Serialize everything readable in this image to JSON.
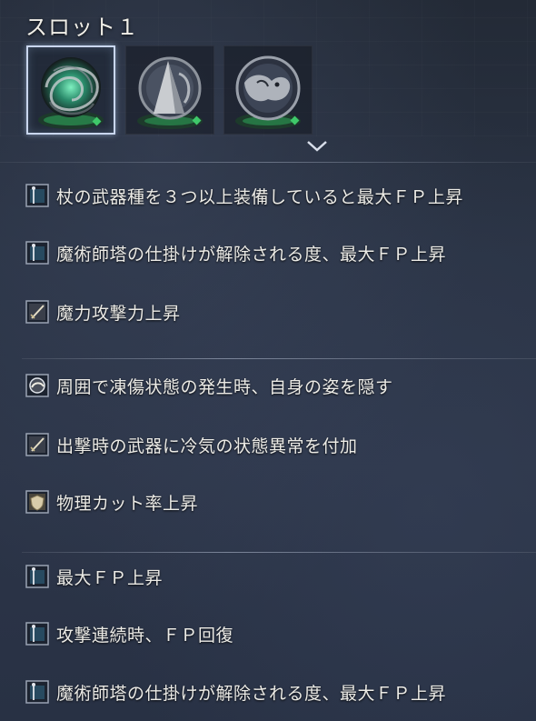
{
  "header": {
    "title": "スロット１"
  },
  "relics": [
    {
      "icon": "vortex-relic-icon",
      "selected": true
    },
    {
      "icon": "cloaked-figure-relic-icon",
      "selected": false
    },
    {
      "icon": "beast-relic-icon",
      "selected": false
    }
  ],
  "colors": {
    "accent_frame": "#c9d6ee",
    "gem_green": "#3fc86a",
    "text": "#ecebe6"
  },
  "effect_groups": [
    {
      "effects": [
        {
          "icon": "staff-icon",
          "text": "杖の武器種を３つ以上装備していると最大ＦＰ上昇"
        },
        {
          "icon": "staff-icon",
          "text": "魔術師塔の仕掛けが解除される度、最大ＦＰ上昇"
        },
        {
          "icon": "sword-icon",
          "text": "魔力攻撃力上昇"
        }
      ]
    },
    {
      "effects": [
        {
          "icon": "mask-icon",
          "text": "周囲で凍傷状態の発生時、自身の姿を隠す"
        },
        {
          "icon": "sword-icon",
          "text": "出撃時の武器に冷気の状態異常を付加"
        },
        {
          "icon": "shield-icon",
          "text": "物理カット率上昇"
        }
      ]
    },
    {
      "effects": [
        {
          "icon": "staff-icon",
          "text": "最大ＦＰ上昇"
        },
        {
          "icon": "staff-icon",
          "text": "攻撃連続時、ＦＰ回復"
        },
        {
          "icon": "staff-icon",
          "text": "魔術師塔の仕掛けが解除される度、最大ＦＰ上昇"
        }
      ]
    }
  ]
}
